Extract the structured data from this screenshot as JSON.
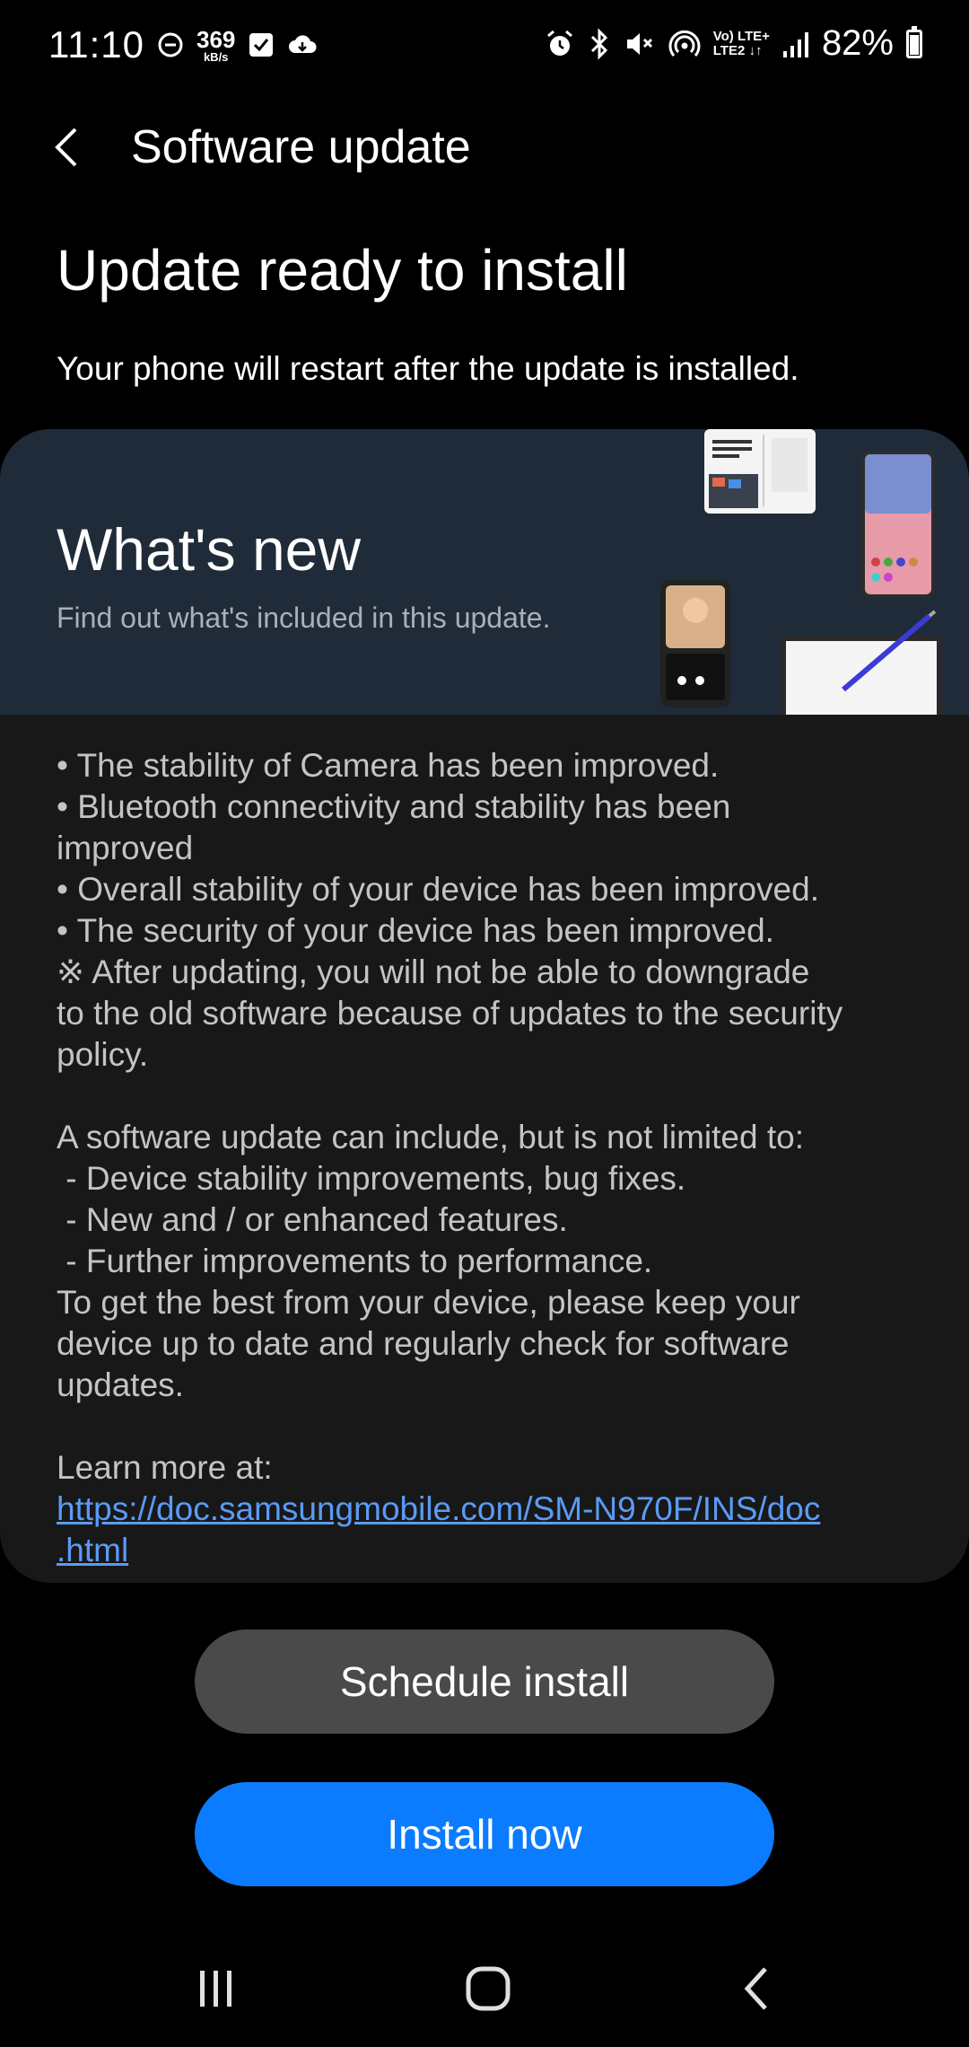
{
  "status_bar": {
    "time": "11:10",
    "speed_value": "369",
    "speed_unit": "kB/s",
    "lte_top": "Vo) LTE+",
    "lte_bottom": "LTE2 ↓↑",
    "battery": "82%",
    "battery_level": 0.82
  },
  "appbar": {
    "title": "Software update"
  },
  "page": {
    "headline": "Update ready to install",
    "subline": "Your phone will restart after the update is installed."
  },
  "whats_new": {
    "title": "What's new",
    "subtitle": "Find out what's included in this update."
  },
  "release_notes": {
    "lines": [
      "• The stability of Camera has been improved.",
      "• Bluetooth connectivity and stability has been",
      "improved",
      "• Overall stability of your device has been improved.",
      "• The security of your device has been improved.",
      "※ After updating, you will not be able to downgrade",
      "to the old software because of updates to the security",
      "policy.",
      "",
      "A software update can include, but is not limited to:",
      " - Device stability improvements, bug fixes.",
      " - New and / or enhanced features.",
      " - Further improvements to performance.",
      "To get the best from your device, please keep your",
      "device up to date and regularly check for software",
      "updates.",
      "",
      "Learn more at:"
    ],
    "link_line1": "https://doc.samsungmobile.com/SM-N970F/INS/doc",
    "link_line2": ".html"
  },
  "buttons": {
    "schedule": "Schedule install",
    "install": "Install now"
  },
  "colors": {
    "background": "#000000",
    "card": "#181818",
    "card_header": "#1f2b38",
    "primary_button": "#0b7cff",
    "secondary_button": "#4a4a4a",
    "link": "#5a9bf5"
  }
}
